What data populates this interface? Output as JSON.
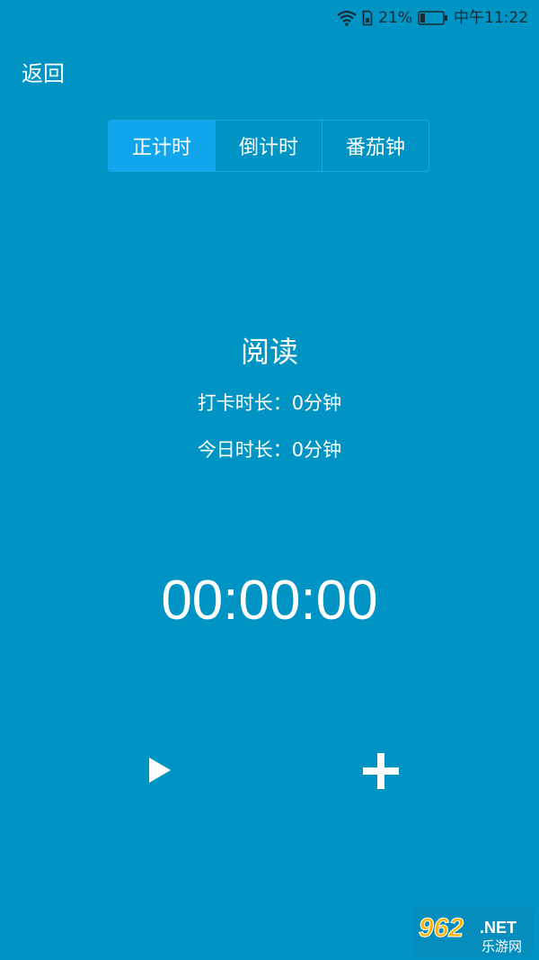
{
  "status_bar": {
    "battery_percent": "21%",
    "time": "中午11:22",
    "icons": [
      "wifi-icon",
      "sim-card-icon",
      "battery-icon"
    ],
    "battery_level": 0.21
  },
  "nav": {
    "back_label": "返回"
  },
  "mode_tabs": [
    {
      "label": "正计时",
      "active": true
    },
    {
      "label": "倒计时",
      "active": false
    },
    {
      "label": "番茄钟",
      "active": false
    }
  ],
  "activity": {
    "name": "阅读",
    "checkin_duration": "打卡时长：0分钟",
    "today_duration": "今日时长：0分钟"
  },
  "timer": {
    "display": "00:00:00"
  },
  "controls": {
    "play_icon": "play-icon",
    "add_icon": "plus-icon"
  },
  "colors": {
    "background": "#0094c4",
    "tab_active": "#11a6eb",
    "tab_border": "#19a9e9",
    "text": "#ffffff",
    "status_text": "#1a2a33"
  },
  "watermark": {
    "brand": "962",
    "suffix": ".NET",
    "caption": "乐游网"
  }
}
